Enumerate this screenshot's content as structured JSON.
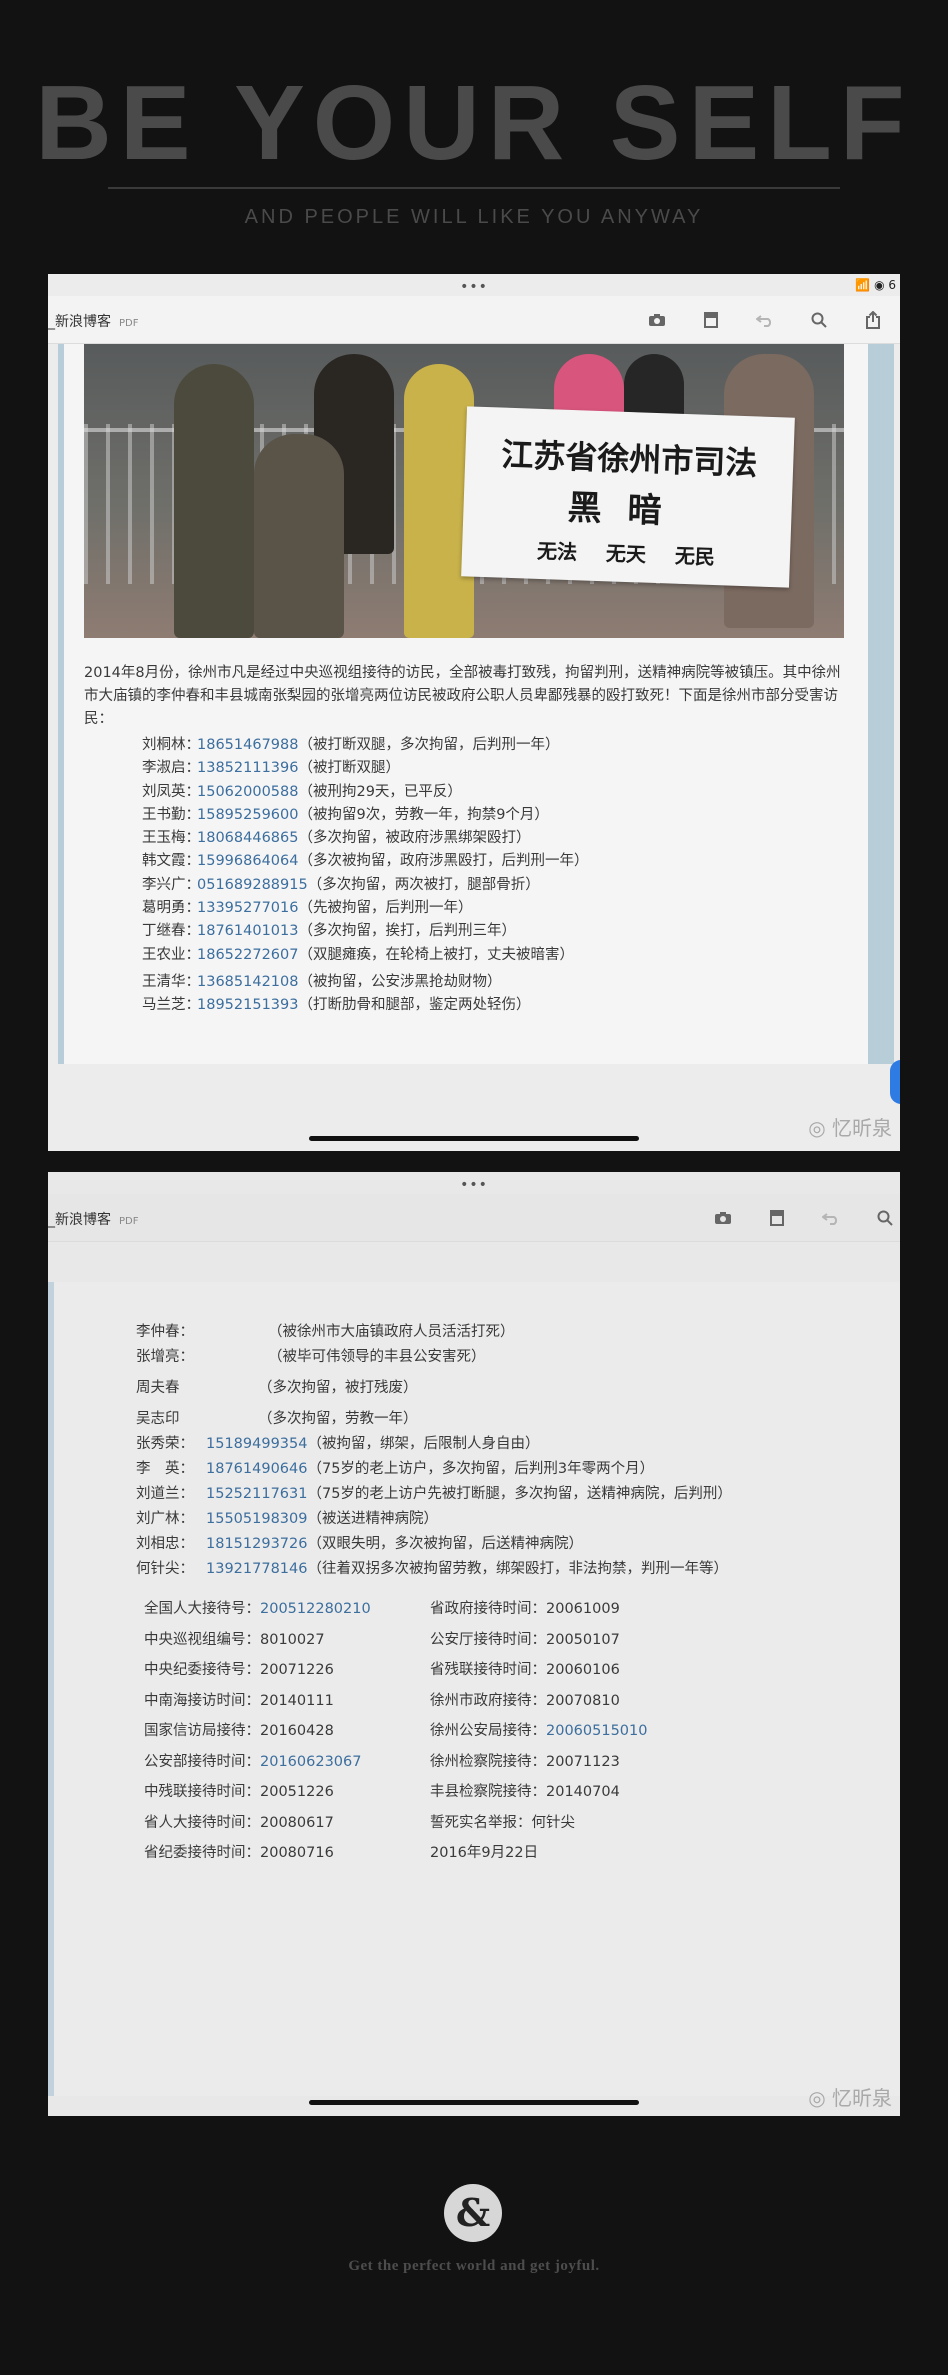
{
  "header": {
    "title": "BE YOUR SELF",
    "subtitle": "AND PEOPLE WILL LIKE YOU ANYWAY"
  },
  "shot1": {
    "status_dots": "•••",
    "status_icons": "📶 ◉ 6",
    "tab_label": "_新浪博客",
    "tab_badge": "PDF",
    "toolbar_icons": [
      "camera-icon",
      "bookmark-icon",
      "undo-icon",
      "search-icon",
      "share-icon"
    ],
    "banner": {
      "line1": "江苏省徐州市司法",
      "line2": "黑暗",
      "line3": "无法 无天 无民"
    },
    "intro": "2014年8月份，徐州市凡是经过中央巡视组接待的访民，全部被毒打致残，拘留判刑，送精神病院等被镇压。其中徐州市大庙镇的李仲春和丰县城南张梨园的张增亮两位访民被政府公职人员卑鄙残暴的殴打致死！下面是徐州市部分受害访民：",
    "victims": [
      {
        "name": "刘桐林：",
        "phone": "18651467988",
        "note": "（被打断双腿，多次拘留，后判刑一年）"
      },
      {
        "name": "李淑启：",
        "phone": "13852111396",
        "note": "（被打断双腿）"
      },
      {
        "name": "刘凤英：",
        "phone": "15062000588",
        "note": "（被刑拘29天，已平反）"
      },
      {
        "name": "王书勤：",
        "phone": "15895259600",
        "note": "（被拘留9次，劳教一年，拘禁9个月）"
      },
      {
        "name": "王玉梅：",
        "phone": "18068446865",
        "note": "（多次拘留，被政府涉黑绑架殴打）"
      },
      {
        "name": "韩文霞：",
        "phone": "15996864064",
        "note": "（多次被拘留，政府涉黑殴打，后判刑一年）"
      },
      {
        "name": "李兴广：",
        "phone": "051689288915",
        "note": "（多次拘留，两次被打，腿部骨折）"
      },
      {
        "name": "葛明勇：",
        "phone": "13395277016",
        "note": "（先被拘留，后判刑一年）"
      },
      {
        "name": "丁继春：",
        "phone": "18761401013",
        "note": "（多次拘留，挨打，后判刑三年）"
      },
      {
        "name": "王农业：",
        "phone": "18652272607",
        "note": "（双腿瘫痪，在轮椅上被打，丈夫被暗害）"
      },
      {
        "name": "王清华：",
        "phone": "13685142108",
        "note": "（被拘留，公安涉黑抢劫财物）"
      },
      {
        "name": "马兰芝：",
        "phone": "18952151393",
        "note": "（打断肋骨和腿部，鉴定两处轻伤）"
      }
    ],
    "watermark": "◎ 忆昕泉"
  },
  "shot2": {
    "status_dots": "•••",
    "tab_label": "_新浪博客",
    "tab_badge": "PDF",
    "toolbar_icons": [
      "camera-icon",
      "bookmark-icon",
      "undo-icon",
      "search-icon"
    ],
    "persons": [
      {
        "name": "李仲春：",
        "phone": "",
        "note": "（被徐州市大庙镇政府人员活活打死）"
      },
      {
        "name": "张增亮：",
        "phone": "",
        "note": "（被毕可伟领导的丰县公安害死）"
      },
      {
        "name": "周夫春",
        "phone": "",
        "note": "（多次拘留，被打残废）"
      },
      {
        "name": "吴志印",
        "phone": "",
        "note": "（多次拘留，劳教一年）"
      },
      {
        "name": "张秀荣：",
        "phone": "15189499354",
        "note": "（被拘留，绑架，后限制人身自由）"
      },
      {
        "name": "李　英：",
        "phone": "18761490646",
        "note": "（75岁的老上访户，多次拘留，后判刑3年零两个月）"
      },
      {
        "name": "刘道兰：",
        "phone": "15252117631",
        "note": "（75岁的老上访户先被打断腿，多次拘留，送精神病院，后判刑）"
      },
      {
        "name": "刘广林：",
        "phone": "15505198309",
        "note": "（被送进精神病院）"
      },
      {
        "name": "刘相忠：",
        "phone": "18151293726",
        "note": "（双眼失明，多次被拘留，后送精神病院）"
      },
      {
        "name": "何针尖：",
        "phone": "13921778146",
        "note": "（往着双拐多次被拘留劳教，绑架殴打，非法拘禁，判刑一年等）"
      }
    ],
    "receptions": [
      {
        "left_label": "全国人大接待号：",
        "left_value": "200512280210",
        "right_label": "省政府接待时间：",
        "right_value": "20061009"
      },
      {
        "left_label": "中央巡视组编号：",
        "left_value": "8010027",
        "right_label": "公安厅接待时间：",
        "right_value": "20050107"
      },
      {
        "left_label": "中央纪委接待号：",
        "left_value": "20071226",
        "right_label": "省残联接待时间：",
        "right_value": "20060106"
      },
      {
        "left_label": "中南海接访时间：",
        "left_value": "20140111",
        "right_label": "徐州市政府接待：",
        "right_value": "20070810"
      },
      {
        "left_label": "国家信访局接待：",
        "left_value": "20160428",
        "right_label": "徐州公安局接待：",
        "right_value": "20060515010"
      },
      {
        "left_label": "公安部接待时间：",
        "left_value": "20160623067",
        "right_label": "徐州检察院接待：",
        "right_value": "20071123"
      },
      {
        "left_label": "中残联接待时间：",
        "left_value": "20051226",
        "right_label": "丰县检察院接待：",
        "right_value": "20140704"
      },
      {
        "left_label": "省人大接待时间：",
        "left_value": "20080617",
        "right_label": "誓死实名举报：",
        "right_value": "何针尖"
      },
      {
        "left_label": "省纪委接待时间：",
        "left_value": "20080716",
        "right_label": "2016年9月22日",
        "right_value": ""
      }
    ],
    "watermark": "◎ 忆昕泉"
  },
  "footer": {
    "symbol": "&",
    "tagline": "Get the perfect world and get joyful."
  }
}
